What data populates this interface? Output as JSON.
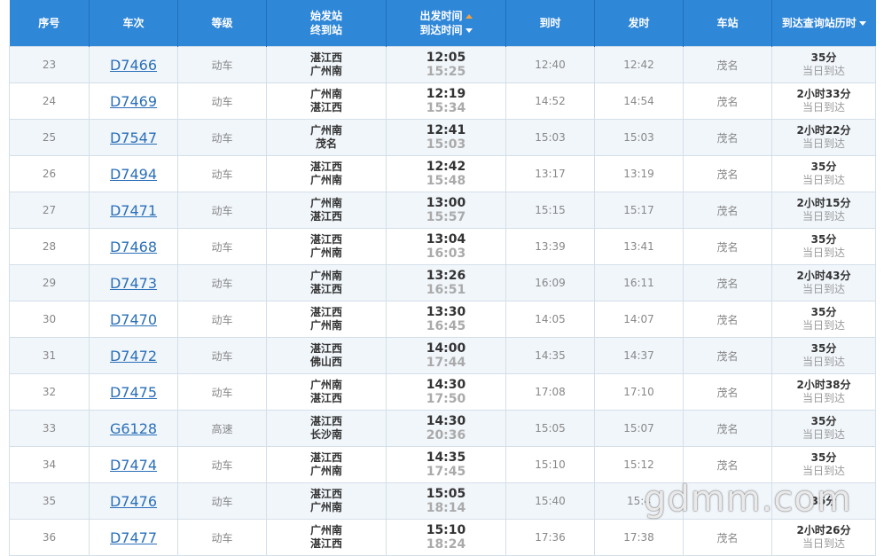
{
  "header": {
    "seq": "序号",
    "train": "车次",
    "grade": "等级",
    "stations_line1": "始发站",
    "stations_line2": "终到站",
    "times_line1": "出发时间",
    "times_line2": "到达时间",
    "arrive": "到时",
    "depart": "发时",
    "station": "车站",
    "duration": "到达查询站历时"
  },
  "rows": [
    {
      "seq": "23",
      "train": "D7466",
      "grade": "动车",
      "from": "湛江西",
      "to": "广州南",
      "dep": "12:05",
      "arr": "15:25",
      "arrive": "12:40",
      "depart": "12:42",
      "station": "茂名",
      "dur": "35分",
      "day": "当日到达"
    },
    {
      "seq": "24",
      "train": "D7469",
      "grade": "动车",
      "from": "广州南",
      "to": "湛江西",
      "dep": "12:19",
      "arr": "15:34",
      "arrive": "14:52",
      "depart": "14:54",
      "station": "茂名",
      "dur": "2小时33分",
      "day": "当日到达"
    },
    {
      "seq": "25",
      "train": "D7547",
      "grade": "动车",
      "from": "广州南",
      "to": "茂名",
      "dep": "12:41",
      "arr": "15:03",
      "arrive": "15:03",
      "depart": "15:03",
      "station": "茂名",
      "dur": "2小时22分",
      "day": "当日到达"
    },
    {
      "seq": "26",
      "train": "D7494",
      "grade": "动车",
      "from": "湛江西",
      "to": "广州南",
      "dep": "12:42",
      "arr": "15:48",
      "arrive": "13:17",
      "depart": "13:19",
      "station": "茂名",
      "dur": "35分",
      "day": "当日到达"
    },
    {
      "seq": "27",
      "train": "D7471",
      "grade": "动车",
      "from": "广州南",
      "to": "湛江西",
      "dep": "13:00",
      "arr": "15:57",
      "arrive": "15:15",
      "depart": "15:17",
      "station": "茂名",
      "dur": "2小时15分",
      "day": "当日到达"
    },
    {
      "seq": "28",
      "train": "D7468",
      "grade": "动车",
      "from": "湛江西",
      "to": "广州南",
      "dep": "13:04",
      "arr": "16:03",
      "arrive": "13:39",
      "depart": "13:41",
      "station": "茂名",
      "dur": "35分",
      "day": "当日到达"
    },
    {
      "seq": "29",
      "train": "D7473",
      "grade": "动车",
      "from": "广州南",
      "to": "湛江西",
      "dep": "13:26",
      "arr": "16:51",
      "arrive": "16:09",
      "depart": "16:11",
      "station": "茂名",
      "dur": "2小时43分",
      "day": "当日到达"
    },
    {
      "seq": "30",
      "train": "D7470",
      "grade": "动车",
      "from": "湛江西",
      "to": "广州南",
      "dep": "13:30",
      "arr": "16:45",
      "arrive": "14:05",
      "depart": "14:07",
      "station": "茂名",
      "dur": "35分",
      "day": "当日到达"
    },
    {
      "seq": "31",
      "train": "D7472",
      "grade": "动车",
      "from": "湛江西",
      "to": "佛山西",
      "dep": "14:00",
      "arr": "17:44",
      "arrive": "14:35",
      "depart": "14:37",
      "station": "茂名",
      "dur": "35分",
      "day": "当日到达"
    },
    {
      "seq": "32",
      "train": "D7475",
      "grade": "动车",
      "from": "广州南",
      "to": "湛江西",
      "dep": "14:30",
      "arr": "17:50",
      "arrive": "17:08",
      "depart": "17:10",
      "station": "茂名",
      "dur": "2小时38分",
      "day": "当日到达"
    },
    {
      "seq": "33",
      "train": "G6128",
      "grade": "高速",
      "from": "湛江西",
      "to": "长沙南",
      "dep": "14:30",
      "arr": "20:36",
      "arrive": "15:05",
      "depart": "15:07",
      "station": "茂名",
      "dur": "35分",
      "day": "当日到达"
    },
    {
      "seq": "34",
      "train": "D7474",
      "grade": "动车",
      "from": "湛江西",
      "to": "广州南",
      "dep": "14:35",
      "arr": "17:45",
      "arrive": "15:10",
      "depart": "15:12",
      "station": "茂名",
      "dur": "35分",
      "day": "当日到达"
    },
    {
      "seq": "35",
      "train": "D7476",
      "grade": "动车",
      "from": "湛江西",
      "to": "广州南",
      "dep": "15:05",
      "arr": "18:14",
      "arrive": "15:40",
      "depart": "15:4",
      "station": "",
      "dur": "35分",
      "day": ""
    },
    {
      "seq": "36",
      "train": "D7477",
      "grade": "动车",
      "from": "广州南",
      "to": "湛江西",
      "dep": "15:10",
      "arr": "18:24",
      "arrive": "17:36",
      "depart": "17:38",
      "station": "茂名",
      "dur": "2小时26分",
      "day": "当日到达"
    }
  ],
  "watermark": "gdmm.com"
}
